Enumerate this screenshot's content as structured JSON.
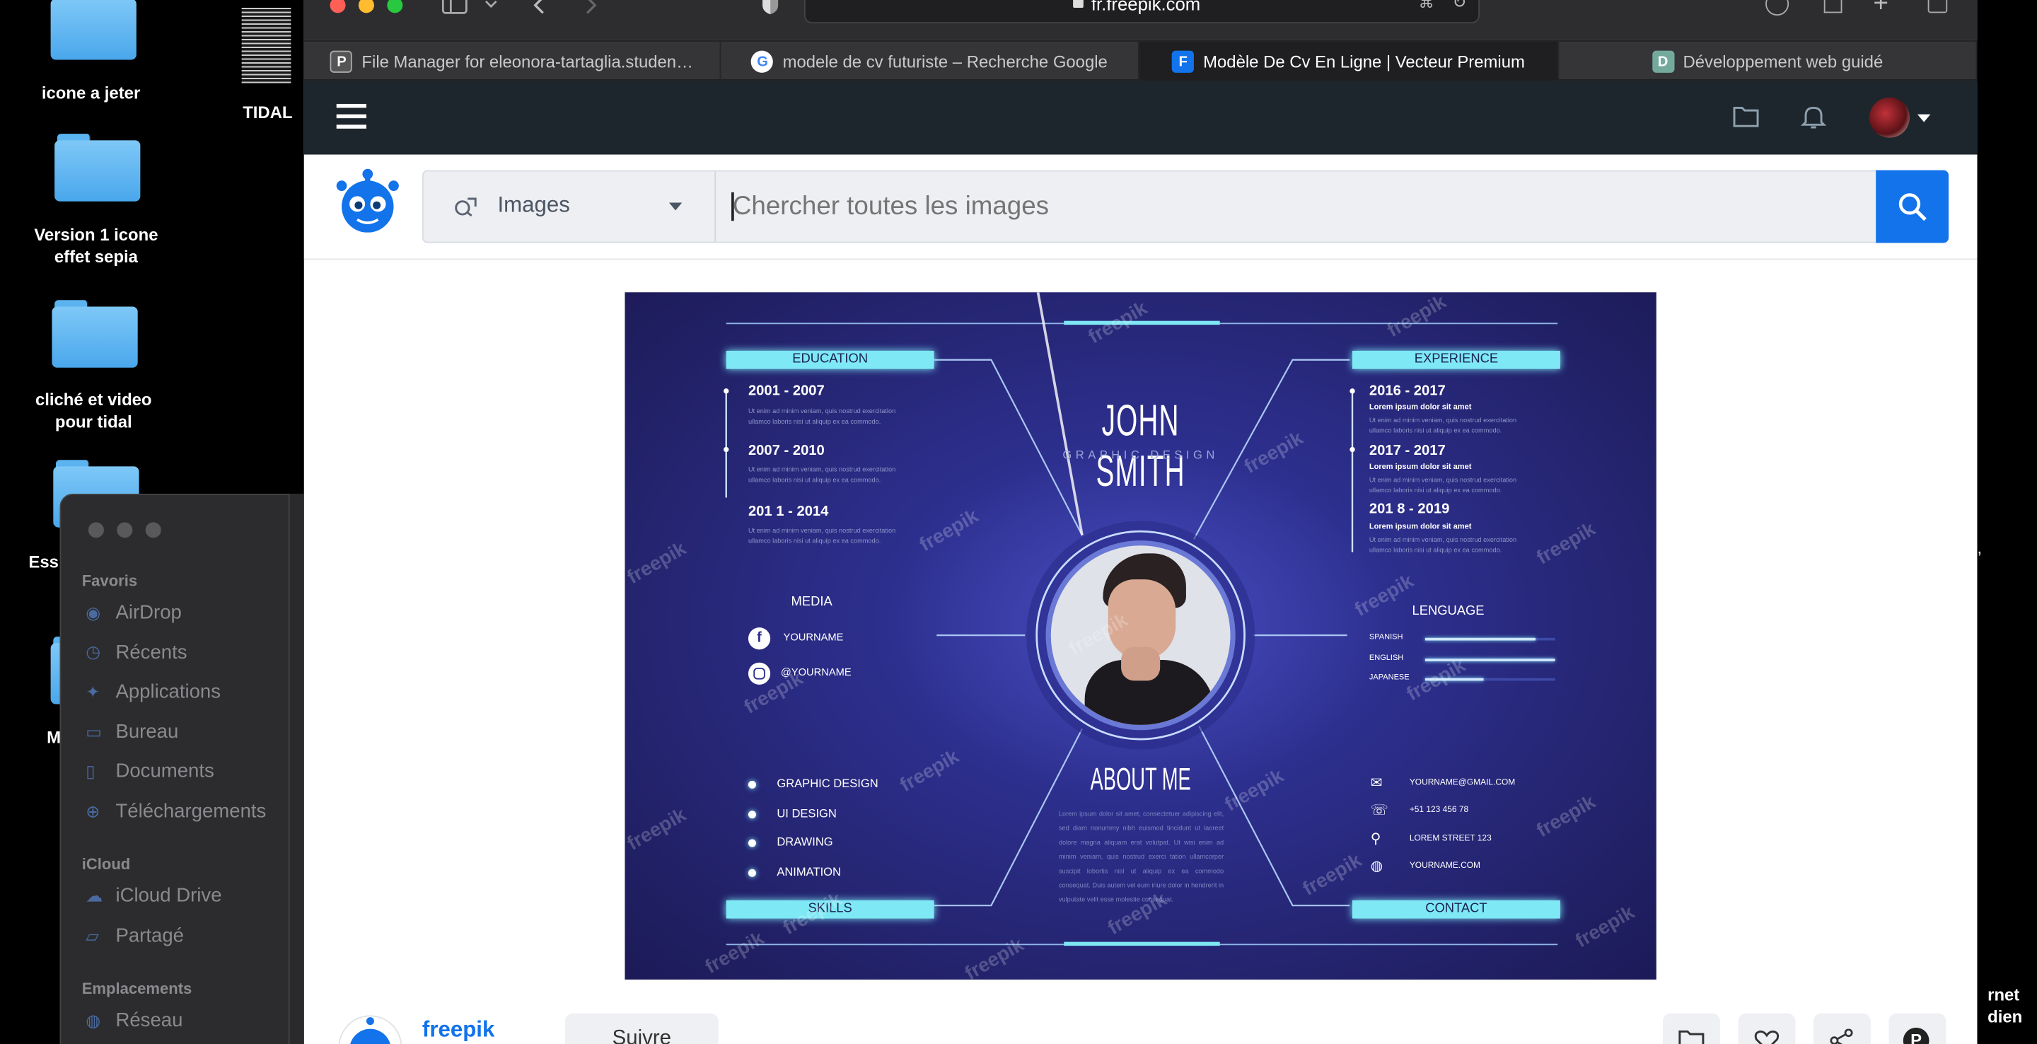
{
  "desktop": {
    "icons": [
      {
        "label": "icone a jeter"
      },
      {
        "label": "Version 1 icone effet sepia"
      },
      {
        "label": "cliché et video pour tidal"
      },
      {
        "label": "Ess"
      },
      {
        "label": "M"
      }
    ],
    "tidal_label": "TIDAL",
    "right_fragment_1": "rnet",
    "right_fragment_2": "dien",
    "right_fragment_3": ","
  },
  "finder": {
    "section_favorites": "Favoris",
    "favorites": [
      "AirDrop",
      "Récents",
      "Applications",
      "Bureau",
      "Documents",
      "Téléchargements"
    ],
    "section_icloud": "iCloud",
    "icloud": [
      "iCloud Drive",
      "Partagé"
    ],
    "section_locations": "Emplacements",
    "locations": [
      "Réseau"
    ]
  },
  "browser": {
    "url": "fr.freepik.com",
    "tabs": [
      {
        "label": "File Manager for eleonora-tartaglia.studen…",
        "favicon": "P"
      },
      {
        "label": "modele de cv futuriste – Recherche Google",
        "favicon": "G"
      },
      {
        "label": "Modèle De Cv En Ligne | Vecteur Premium",
        "favicon": "F"
      },
      {
        "label": "Développement web guidé",
        "favicon": "D"
      }
    ]
  },
  "freepik": {
    "search_type": "Images",
    "search_placeholder": "Chercher toutes les images",
    "author_name": "freepik",
    "follow_label": "Suivre",
    "watermark": "freepik"
  },
  "cv": {
    "name": "JOHN SMITH",
    "role": "GRAPHIC DESIGN",
    "education_title": "EDUCATION",
    "education": [
      {
        "years": "2001 - 2007"
      },
      {
        "years": "2007 - 2010"
      },
      {
        "years": "201 1 - 2014"
      }
    ],
    "lorem_short": "Ut enim ad minim veniam, quis nostrud exercitation ullamco laboris nisi ut aliquip ex ea commodo.",
    "experience_title": "EXPERIENCE",
    "experience": [
      {
        "years": "2016 - 2017",
        "sub": "Lorem ipsum dolor sit amet"
      },
      {
        "years": "2017 - 2017",
        "sub": "Lorem ipsum dolor sit amet"
      },
      {
        "years": "201 8 - 2019",
        "sub": "Lorem ipsum dolor sit amet"
      }
    ],
    "media_title": "MEDIA",
    "media": [
      "YOURNAME",
      "@YOURNAME"
    ],
    "language_title": "LENGUAGE",
    "languages": [
      {
        "name": "SPANISH",
        "level": 0.85
      },
      {
        "name": "ENGLISH",
        "level": 1.0
      },
      {
        "name": "JAPANESE",
        "level": 0.45
      }
    ],
    "skills_title": "SKILLS",
    "skills": [
      "GRAPHIC DESIGN",
      "UI DESIGN",
      "DRAWING",
      "ANIMATION"
    ],
    "about_title": "ABOUT ME",
    "about_text": "Lorem ipsum dolor sit amet, consectetuer adipiscing elit, sed diam nonummy nibh euismod tincidunt ut laoreet dolore magna aliquam erat volutpat. Ut wisi enim ad minim veniam, quis nostrud exerci tation ullamcorper suscipit lobortis nisl ut aliquip ex ea commodo consequat. Duis autem vel eum iriure dolor in hendrerit in vulputate velit esse molestie consequat.",
    "contact_title": "CONTACT",
    "contact": [
      "YOURNAME@GMAIL.COM",
      "+51 123 456 78",
      "LOREM STREET 123",
      "YOURNAME.COM"
    ],
    "colors": {
      "accent": "#7ee8f5",
      "background": "#2a2a78",
      "text": "#ffffff"
    }
  }
}
